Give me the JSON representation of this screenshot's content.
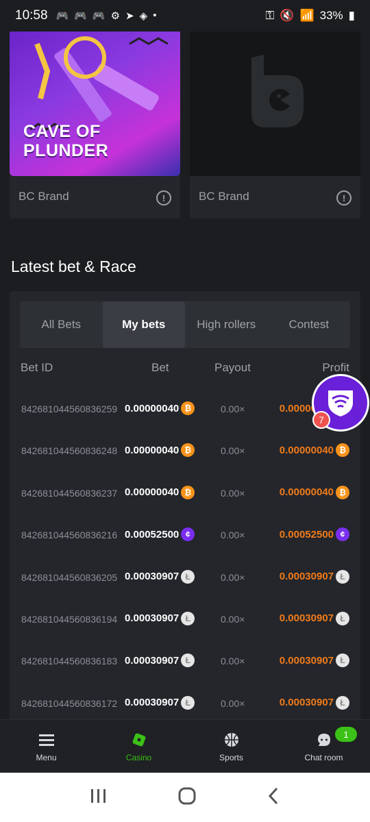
{
  "status_bar": {
    "time": "10:58",
    "battery": "33%"
  },
  "cards": [
    {
      "title_line1": "CAVE OF",
      "title_line2": "PLUNDER",
      "brand": "BC Brand",
      "info": "!"
    },
    {
      "brand": "BC Brand",
      "info": "!"
    }
  ],
  "section": {
    "title": "Latest bet & Race"
  },
  "tabs": [
    {
      "label": "All Bets",
      "active": false
    },
    {
      "label": "My bets",
      "active": true
    },
    {
      "label": "High rollers",
      "active": false
    },
    {
      "label": "Contest",
      "active": false
    }
  ],
  "table": {
    "headers": {
      "bet_id": "Bet ID",
      "bet": "Bet",
      "payout": "Payout",
      "profit": "Profit"
    },
    "rows": [
      {
        "id": "842681044560836259",
        "bet": "0.00000040",
        "coin": "btc",
        "payout": "0.00×",
        "profit": "0.00000040"
      },
      {
        "id": "842681044560836248",
        "bet": "0.00000040",
        "coin": "btc",
        "payout": "0.00×",
        "profit": "0.00000040"
      },
      {
        "id": "842681044560836237",
        "bet": "0.00000040",
        "coin": "btc",
        "payout": "0.00×",
        "profit": "0.00000040"
      },
      {
        "id": "842681044560836216",
        "bet": "0.00052500",
        "coin": "bcd",
        "payout": "0.00×",
        "profit": "0.00052500"
      },
      {
        "id": "842681044560836205",
        "bet": "0.00030907",
        "coin": "ltc",
        "payout": "0.00×",
        "profit": "0.00030907"
      },
      {
        "id": "842681044560836194",
        "bet": "0.00030907",
        "coin": "ltc",
        "payout": "0.00×",
        "profit": "0.00030907"
      },
      {
        "id": "842681044560836183",
        "bet": "0.00030907",
        "coin": "ltc",
        "payout": "0.00×",
        "profit": "0.00030907"
      },
      {
        "id": "842681044560836172",
        "bet": "0.00030907",
        "coin": "ltc",
        "payout": "0.00×",
        "profit": "0.00030907"
      }
    ]
  },
  "fab": {
    "badge": "7"
  },
  "bottom_nav": [
    {
      "label": "Menu",
      "icon": "menu-icon",
      "active": false
    },
    {
      "label": "Casino",
      "icon": "casino-icon",
      "active": true
    },
    {
      "label": "Sports",
      "icon": "sports-icon",
      "active": false
    },
    {
      "label": "Chat room",
      "icon": "chat-icon",
      "active": false,
      "badge": "1"
    }
  ],
  "colors": {
    "accent": "#3bc117",
    "profit": "#f07b1a",
    "btc": "#f7931a",
    "bcd": "#7a2ef0",
    "fab": "#6a1fd8"
  }
}
